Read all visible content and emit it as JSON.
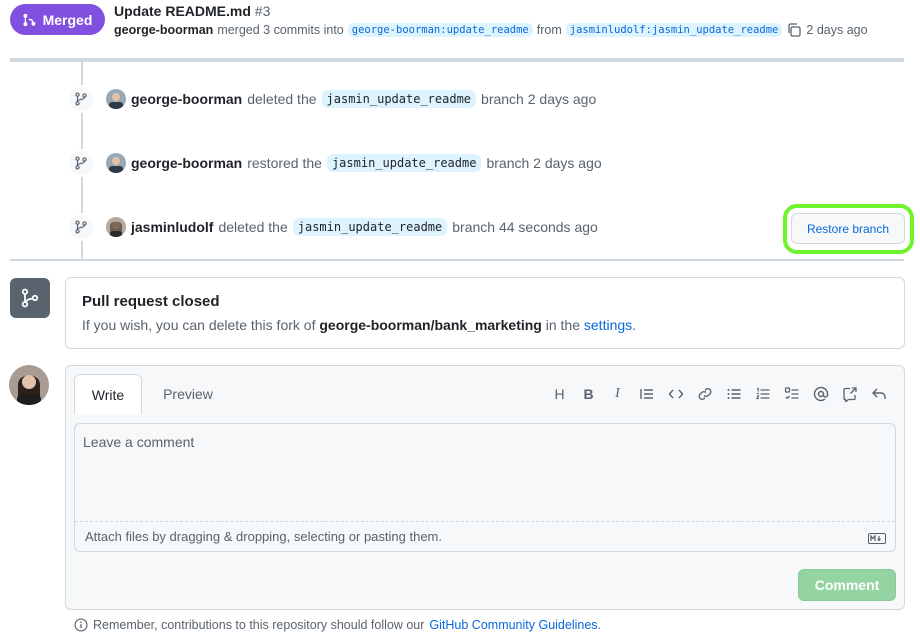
{
  "header": {
    "status_badge": "Merged",
    "title": "Update README.md",
    "number": "#3",
    "author": "george-boorman",
    "merged_text": "merged 3 commits into",
    "base_branch": "george-boorman:update_readme",
    "from_text": "from",
    "head_branch": "jasminludolf:jasmin_update_readme",
    "time": "2 days ago"
  },
  "timeline": [
    {
      "user": "george-boorman",
      "action": "deleted the",
      "branch": "jasmin_update_readme",
      "suffix": "branch 2 days ago"
    },
    {
      "user": "george-boorman",
      "action": "restored the",
      "branch": "jasmin_update_readme",
      "suffix": "branch 2 days ago"
    },
    {
      "user": "jasminludolf",
      "action": "deleted the",
      "branch": "jasmin_update_readme",
      "suffix": "branch 44 seconds ago"
    }
  ],
  "restore_button": "Restore branch",
  "closed": {
    "title": "Pull request closed",
    "msg_prefix": "If you wish, you can delete this fork of",
    "repo": "george-boorman/bank_marketing",
    "msg_mid": "in the",
    "settings_link": "settings",
    "msg_end": "."
  },
  "editor": {
    "tab_write": "Write",
    "tab_preview": "Preview",
    "toolbar": {
      "heading": "H",
      "bold": "B",
      "italic": "I"
    },
    "placeholder": "Leave a comment",
    "attach_text": "Attach files by dragging & dropping, selecting or pasting them.",
    "comment_button": "Comment"
  },
  "guidelines": {
    "prefix": "Remember, contributions to this repository should follow our",
    "link": "GitHub Community Guidelines",
    "suffix": "."
  },
  "colors": {
    "merged": "#8250df",
    "link": "#0969da",
    "highlight": "#6ff32b",
    "comment_btn": "#94d3a2"
  }
}
